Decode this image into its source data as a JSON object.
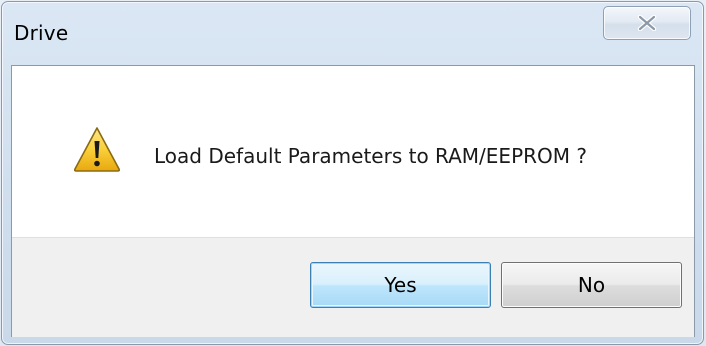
{
  "window": {
    "title": "Drive",
    "close_glyph": "✕"
  },
  "dialog": {
    "icon": "warning-icon",
    "message": "Load Default Parameters to RAM/EEPROM ?"
  },
  "buttons": {
    "yes_label": "Yes",
    "no_label": "No"
  },
  "colors": {
    "frame": "#cfdeee",
    "client_bg": "#ffffff",
    "button_bar_bg": "#f0f0f0",
    "warning_yellow": "#f7c52b",
    "focus_blue": "#3c7fb1"
  }
}
